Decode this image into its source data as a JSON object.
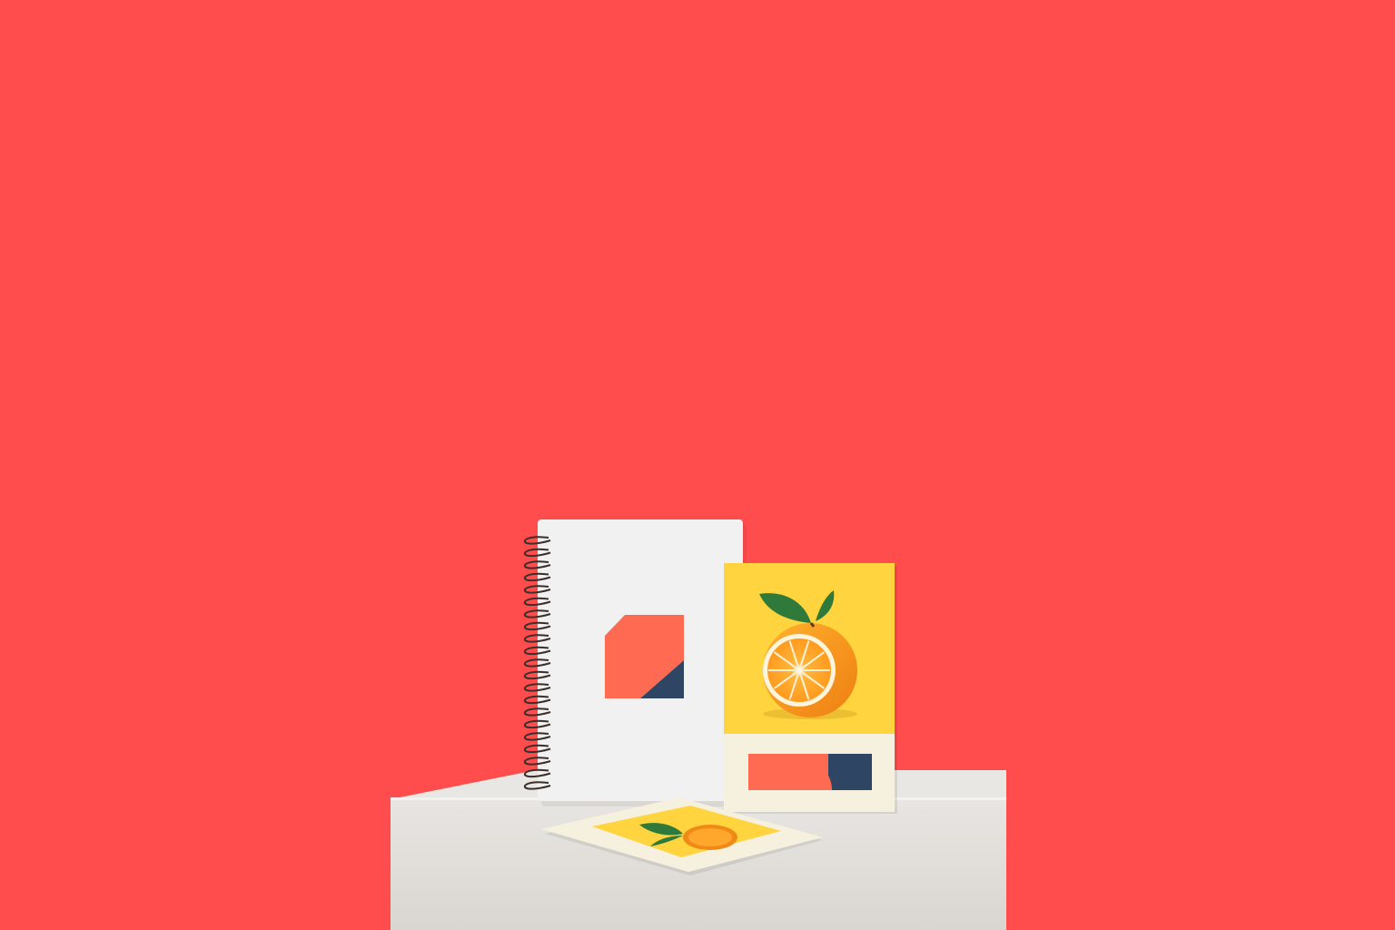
{
  "scene": {
    "description_objects": [
      "backdrop",
      "pedestal",
      "spiral-notebook",
      "postcard-standing",
      "postcard-flat"
    ]
  },
  "colors": {
    "backdrop": "#FF4D4D",
    "pedestal_top": "#E9E7E3",
    "pedestal_front": "#E2E0DC",
    "pedestal_shadow": "#CFCBC5",
    "notebook_cover": "#F1F1F1",
    "coral": "#FF6B52",
    "navy": "#2E4663",
    "card_yellow": "#FFD43E",
    "card_cream": "#F6F0DE",
    "orange_peel": "#F59A1D",
    "orange_flesh": "#FFA12B",
    "orange_pith": "#FFF4DC",
    "leaf": "#2F7A3A",
    "spiral": "#3A2F2A"
  },
  "icons": {
    "notebook_logo": "coral-navy-geometric-logo-icon",
    "card_fruit": "orange-with-leaves-icon",
    "card_logo": "coral-navy-semicircle-logo-icon"
  }
}
